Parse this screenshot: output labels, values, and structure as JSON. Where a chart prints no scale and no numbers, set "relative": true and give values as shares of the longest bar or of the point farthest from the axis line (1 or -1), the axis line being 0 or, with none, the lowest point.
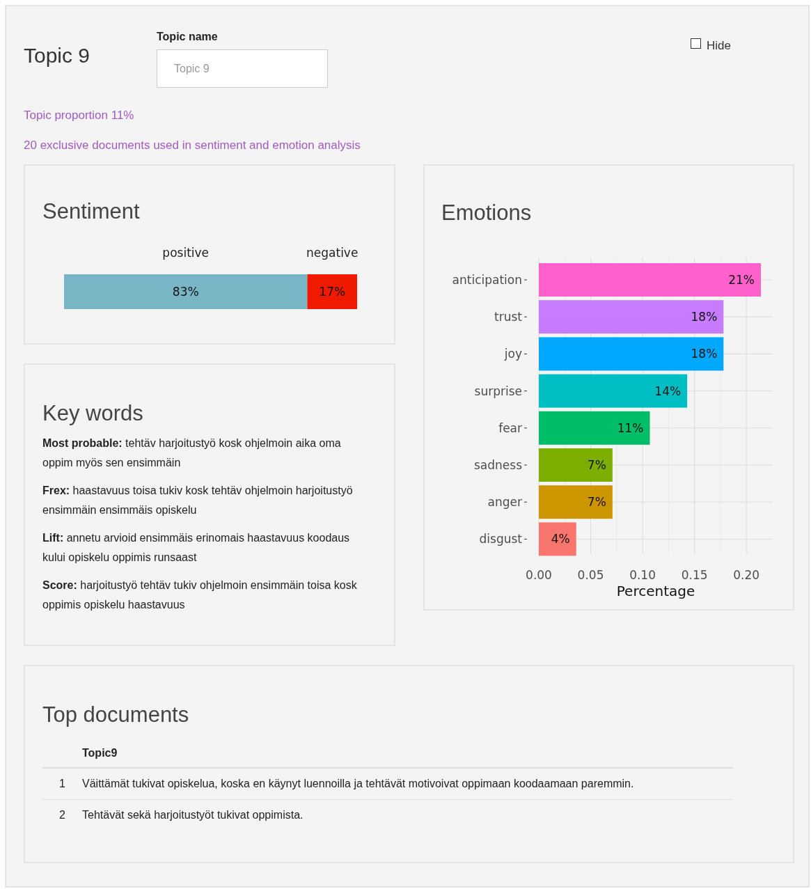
{
  "header": {
    "title": "Topic 9",
    "name_label": "Topic name",
    "name_placeholder": "Topic 9",
    "hide": {
      "label": "Hide",
      "checked": false
    }
  },
  "info": [
    "Topic proportion 11%",
    "20 exclusive documents used in sentiment and emotion analysis"
  ],
  "sentiment": {
    "title": "Sentiment",
    "chart_data": {
      "type": "bar",
      "orientation": "horizontal",
      "stacked": true,
      "relative": true,
      "series": [
        {
          "name": "positive",
          "color": "#78b6c5",
          "values": [
            0.83
          ]
        },
        {
          "name": "negative",
          "color": "#f01a00",
          "values": [
            0.17
          ]
        }
      ],
      "value_labels": [
        "83%",
        "17%"
      ]
    }
  },
  "key_words": {
    "title": "Key words",
    "items": [
      "**Most probable:** tehtäv harjoitustyö kosk ohjelmoin aika oma oppim myös sen ensimmäin",
      "**Frex:** haastavuus toisa tukiv kosk tehtäv ohjelmoin harjoitustyö ensimmäin ensimmäis opiskelu",
      "**Lift:** annetu arvioid ensimmäis erinomais haastavuus koodaus kului opiskelu oppimis runsaast",
      "**Score:** harjoitustyö tehtäv tukiv ohjelmoin ensimmäin toisa kosk oppimis opiskelu haastavuus"
    ]
  },
  "emotions": {
    "title": "Emotions",
    "chart_data": {
      "type": "bar",
      "orientation": "horizontal",
      "xlabel": "Percentage",
      "categories": [
        "anticipation",
        "trust",
        "joy",
        "surprise",
        "fear",
        "sadness",
        "anger",
        "disgust"
      ],
      "series": [
        {
          "values": [
            0.214,
            0.178,
            0.178,
            0.143,
            0.107,
            0.071,
            0.071,
            0.036
          ]
        }
      ],
      "grid": true,
      "colors": [
        "#ff61cc",
        "#c77cff",
        "#00a9ff",
        "#00bfc4",
        "#00be67",
        "#7cae00",
        "#cd9600",
        "#f8766d"
      ],
      "value_labels": [
        "21%",
        "18%",
        "18%",
        "14%",
        "11%",
        "7%",
        "7%",
        "4%"
      ],
      "xlim": [
        0,
        0.2254
      ],
      "xticks": [
        {
          "value": 0,
          "label": "0.00"
        },
        {
          "value": 0.05,
          "label": "0.05"
        },
        {
          "value": 0.1,
          "label": "0.10"
        },
        {
          "value": 0.15,
          "label": "0.15"
        },
        {
          "value": 0.2,
          "label": "0.20"
        }
      ]
    }
  },
  "top_documents": {
    "title": "Top documents",
    "columns": [
      "Topic9"
    ],
    "rows": [
      {
        "index": "1",
        "text": "Väittämät tukivat opiskelua, koska en käynyt luennoilla ja tehtävät motivoivat oppimaan koodaamaan paremmin."
      },
      {
        "index": "2",
        "text": "Tehtävät sekä harjoitustyöt tukivat oppimista."
      }
    ]
  }
}
